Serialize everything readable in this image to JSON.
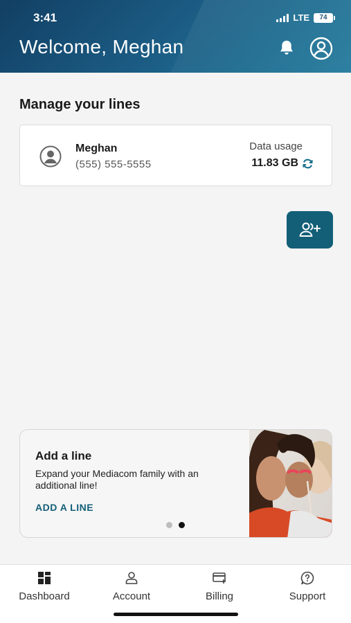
{
  "status_bar": {
    "time": "3:41",
    "network": "LTE",
    "battery": "74"
  },
  "header": {
    "welcome": "Welcome, Meghan"
  },
  "section": {
    "title": "Manage your lines"
  },
  "line_card": {
    "name": "Meghan",
    "phone": "(555) 555-5555",
    "usage_label": "Data usage",
    "usage_value": "11.83 GB"
  },
  "promo": {
    "title": "Add a line",
    "description": "Expand your Mediacom family with an additional line!",
    "link": "ADD A LINE",
    "pagination": {
      "count": 2,
      "active_index": 1
    }
  },
  "tabbar": {
    "items": [
      {
        "label": "Dashboard",
        "icon": "dashboard-icon"
      },
      {
        "label": "Account",
        "icon": "account-icon"
      },
      {
        "label": "Billing",
        "icon": "billing-icon"
      },
      {
        "label": "Support",
        "icon": "support-icon"
      }
    ]
  },
  "colors": {
    "header": "#1b5a82",
    "accent": "#135f78",
    "background": "#f4f4f4"
  }
}
